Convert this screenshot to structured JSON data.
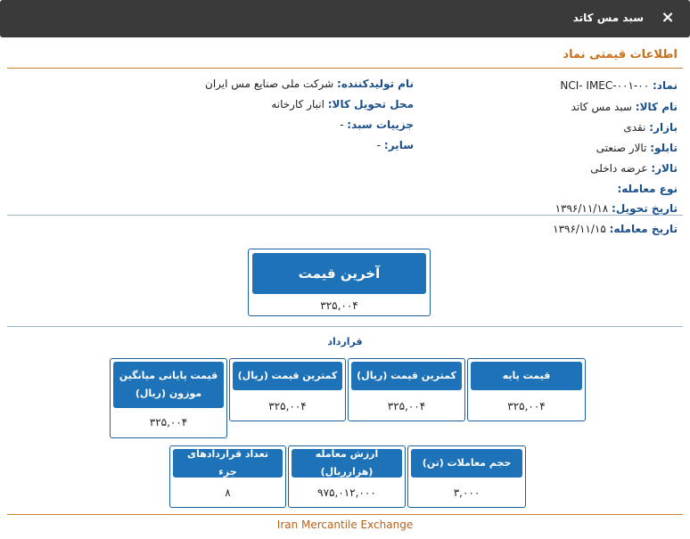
{
  "window": {
    "title": "سبد مس کاتد",
    "close_icon": "close-icon"
  },
  "section": {
    "title": "اطلاعات قیمتی نماد"
  },
  "right_info": [
    {
      "key": "نماد:",
      "value": "NCI- IMEC-۰۰۱-۰۰"
    },
    {
      "key": "نام کالا:",
      "value": "سبد مس کاتد"
    },
    {
      "key": "بازار:",
      "value": "نقدی"
    },
    {
      "key": "تابلو:",
      "value": "تالار صنعتی"
    },
    {
      "key": "تالار:",
      "value": "عرضه داخلی"
    },
    {
      "key": "نوع معامله:",
      "value": ""
    },
    {
      "key": "تاریخ تحویل:",
      "value": "۱۳۹۶/۱۱/۱۸"
    },
    {
      "key": "تاریخ معامله:",
      "value": "۱۳۹۶/۱۱/۱۵"
    }
  ],
  "left_info": [
    {
      "key": "نام تولیدکننده:",
      "value": "شرکت ملی صنایع مس ایران"
    },
    {
      "key": "محل تحویل کالا:",
      "value": "انبار کارخانه"
    },
    {
      "key": "جزییات سبد:",
      "value": "-"
    },
    {
      "key": "سایر:",
      "value": "-"
    }
  ],
  "last_price": {
    "label": "آخرین قیمت",
    "value": "۳۲۵,۰۰۴"
  },
  "contract": {
    "title": "قرارداد",
    "row1": [
      {
        "label": "قیمت پایه",
        "value": "۳۲۵,۰۰۴"
      },
      {
        "label": "کمترین قیمت (ریال)",
        "value": "۳۲۵,۰۰۴"
      },
      {
        "label": "کمترین قیمت (ریال)",
        "value": "۳۲۵,۰۰۴"
      },
      {
        "label": "قیمت پایانی میانگین موزون (ریال)",
        "value": "۳۲۵,۰۰۴"
      }
    ],
    "row2": [
      {
        "label": "حجم معاملات (تن)",
        "value": "۳,۰۰۰"
      },
      {
        "label": "ارزش معامله (هزارریال)",
        "value": "۹۷۵,۰۱۲,۰۰۰"
      },
      {
        "label": "تعداد قراردادهای جزء",
        "value": "۸"
      }
    ]
  },
  "footer": {
    "text": "Iran Mercantile Exchange"
  }
}
